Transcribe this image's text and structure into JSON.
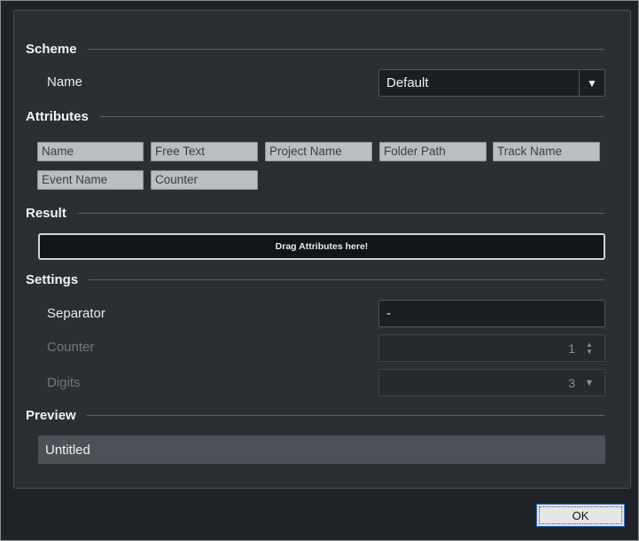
{
  "scheme": {
    "title": "Scheme",
    "name_label": "Name",
    "name_value": "Default",
    "caret": "▼"
  },
  "attributes": {
    "title": "Attributes",
    "chips": [
      "Name",
      "Free Text",
      "Project Name",
      "Folder Path",
      "Track Name",
      "Event Name",
      "Counter"
    ]
  },
  "result": {
    "title": "Result",
    "drop_hint": "Drag Attributes here!"
  },
  "settings": {
    "title": "Settings",
    "separator_label": "Separator",
    "separator_value": "-",
    "counter_label": "Counter",
    "counter_value": "1",
    "digits_label": "Digits",
    "digits_value": "3",
    "caret": "▼",
    "spin_up": "▲",
    "spin_down": "▼"
  },
  "preview": {
    "title": "Preview",
    "value": "Untitled"
  },
  "footer": {
    "ok_label": "OK"
  },
  "colors": {
    "window_bg": "#1f2327",
    "panel_bg": "#2a2f34",
    "chip_bg": "#b9bec3",
    "preview_bg": "#4b5156",
    "ok_focus_border": "#2f6fd0"
  }
}
